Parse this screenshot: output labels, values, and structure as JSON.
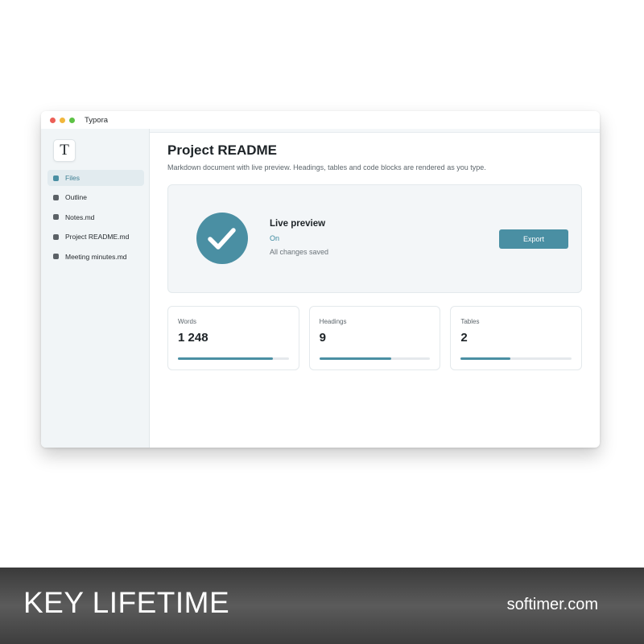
{
  "window": {
    "app_title": "Typora",
    "logo_letter": "T"
  },
  "sidebar": {
    "items": [
      {
        "label": "Files",
        "active": true
      },
      {
        "label": "Outline",
        "active": false
      },
      {
        "label": "Notes.md",
        "active": false
      },
      {
        "label": "Project README.md",
        "active": false
      },
      {
        "label": "Meeting minutes.md",
        "active": false
      }
    ]
  },
  "main": {
    "title": "Project README",
    "subtitle": "Markdown document with live preview. Headings, tables and code blocks are rendered as you type."
  },
  "hero": {
    "icon": "check-icon",
    "title": "Live preview",
    "status": "On",
    "note": "All changes saved",
    "export_label": "Export"
  },
  "stats": [
    {
      "label": "Words",
      "value": "1 248",
      "progress": 0.86
    },
    {
      "label": "Headings",
      "value": "9",
      "progress": 0.65
    },
    {
      "label": "Tables",
      "value": "2",
      "progress": 0.45
    }
  ],
  "banner": {
    "title": "KEY LIFETIME",
    "site": "softimer.com"
  },
  "colors": {
    "accent": "#4a8fa3",
    "sidebar_bg": "#f1f5f7",
    "banner_bg": "#4a4a4a"
  }
}
